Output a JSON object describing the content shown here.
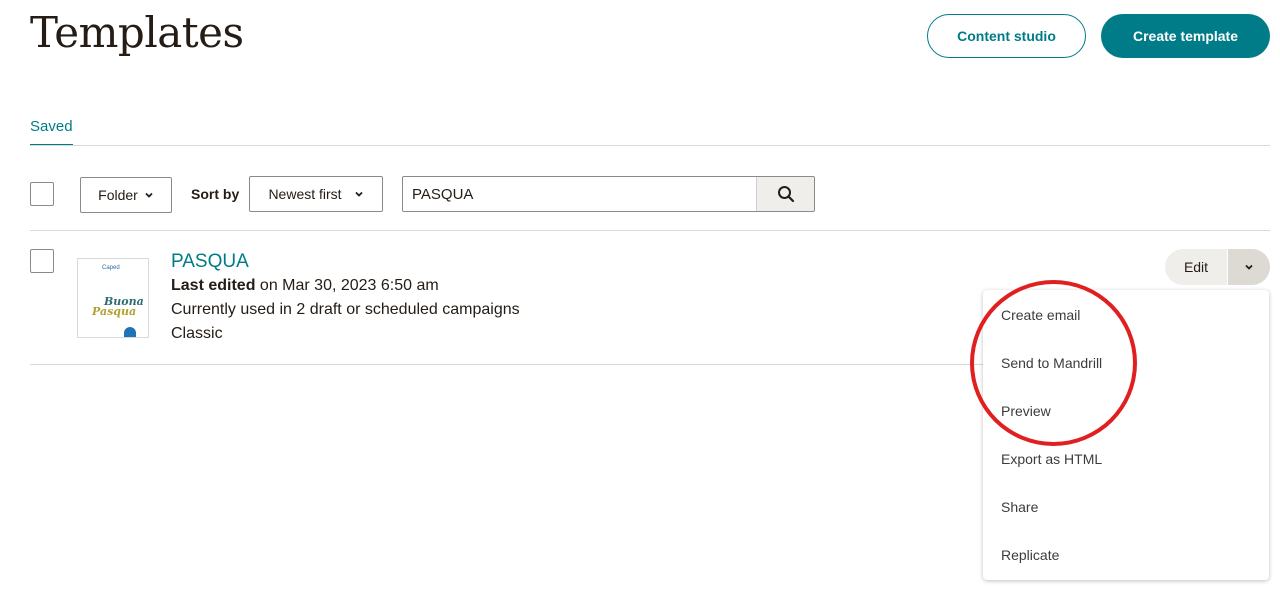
{
  "header": {
    "title": "Templates",
    "content_studio_label": "Content studio",
    "create_template_label": "Create template"
  },
  "tabs": [
    {
      "label": "Saved",
      "active": true
    }
  ],
  "toolbar": {
    "folder_label": "Folder",
    "sort_label": "Sort by",
    "sort_value": "Newest first",
    "search_value": "PASQUA",
    "search_icon": "magnifier-icon"
  },
  "templates": [
    {
      "name": "PASQUA",
      "last_edited_label": "Last edited",
      "last_edited_value": "on Mar 30, 2023 6:50 am",
      "usage": "Currently used in 2 draft or scheduled campaigns",
      "type": "Classic",
      "thumbnail": {
        "logo_text": "Caped",
        "line1": "Buona",
        "line2": "Pasqua"
      },
      "edit_label": "Edit"
    }
  ],
  "dropdown_menu": {
    "items": [
      "Create email",
      "Send to Mandrill",
      "Preview",
      "Export as HTML",
      "Share",
      "Replicate"
    ]
  },
  "colors": {
    "accent": "#007c89",
    "annotation": "#e02020"
  }
}
